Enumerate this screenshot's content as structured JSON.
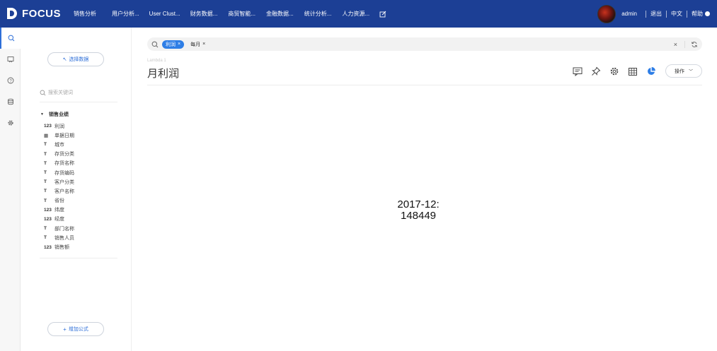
{
  "header": {
    "logo_text": "FOCUS",
    "nav": [
      "销售分析",
      "用户分析...",
      "User Clust...",
      "财务数据...",
      "商贸智能...",
      "金融数据...",
      "统计分析...",
      "人力资源..."
    ],
    "user_name": "admin",
    "logout": "退出",
    "language": "中文",
    "help": "帮助"
  },
  "sidebar": {
    "select_data": "选择数据",
    "search_placeholder": "搜索关键词",
    "group_title": "销售业绩",
    "fields": [
      {
        "icon": "123",
        "label": "利润"
      },
      {
        "icon": "▦",
        "label": "单据日期"
      },
      {
        "icon": "T",
        "label": "城市"
      },
      {
        "icon": "T",
        "label": "存货分类"
      },
      {
        "icon": "T",
        "label": "存货名称"
      },
      {
        "icon": "T",
        "label": "存货编码"
      },
      {
        "icon": "T",
        "label": "客户分类"
      },
      {
        "icon": "T",
        "label": "客户名称"
      },
      {
        "icon": "T",
        "label": "省份"
      },
      {
        "icon": "123",
        "label": "纬度"
      },
      {
        "icon": "123",
        "label": "经度"
      },
      {
        "icon": "T",
        "label": "部门名称"
      },
      {
        "icon": "T",
        "label": "销售人员"
      },
      {
        "icon": "123",
        "label": "销售额"
      }
    ],
    "add_formula": "增加公式"
  },
  "main": {
    "search_tags": [
      {
        "label": "利润",
        "style": "blue"
      },
      {
        "label": "每月",
        "style": "plain"
      }
    ],
    "subtle_label": "Lambda 1",
    "title": "月利润",
    "operation": "操作",
    "result_line1": "2017-12:",
    "result_line2": "148449"
  },
  "colors": {
    "topbar": "#1c3f95",
    "accent": "#2e7ee6"
  }
}
